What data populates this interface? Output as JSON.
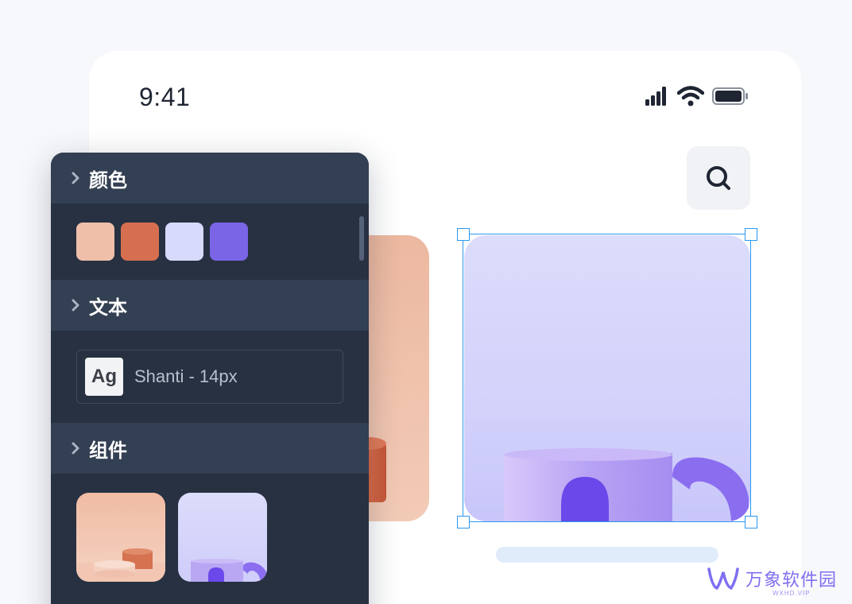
{
  "status_bar": {
    "time": "9:41",
    "icons": [
      "signal-icon",
      "wifi-icon",
      "battery-icon"
    ]
  },
  "search": {
    "icon": "search-icon"
  },
  "panel": {
    "sections": [
      {
        "title": "颜色",
        "icon": "chevron-right-icon"
      },
      {
        "title": "文本",
        "icon": "chevron-right-icon"
      },
      {
        "title": "组件",
        "icon": "chevron-right-icon"
      }
    ],
    "swatches": [
      "#efbfaa",
      "#d56f50",
      "#d8dafc",
      "#7a65e6"
    ],
    "font": {
      "preview": "Ag",
      "label": "Shanti - 14px"
    }
  },
  "colors": {
    "panel_bg": "#273142",
    "section_bg": "#333f52",
    "selection": "#2b98f0",
    "caption_bar": "#e1ecfb"
  },
  "watermark": {
    "name": "万象软件园",
    "sub": "WXHD.VIP"
  }
}
